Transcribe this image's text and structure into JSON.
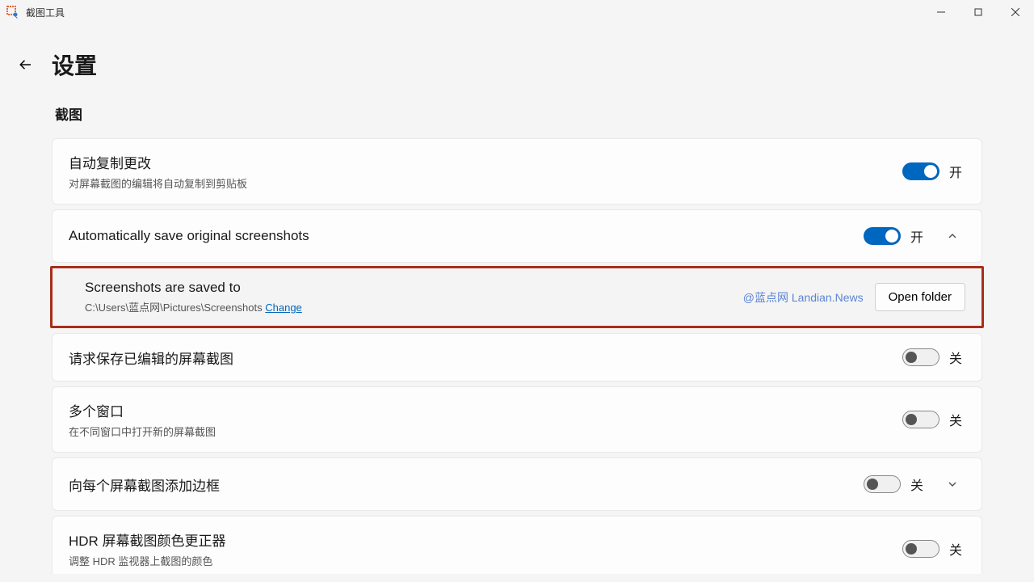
{
  "window": {
    "appTitle": "截图工具"
  },
  "header": {
    "pageTitle": "设置"
  },
  "section": {
    "label": "截图"
  },
  "toggleLabels": {
    "on": "开",
    "off": "关"
  },
  "rows": {
    "autoCopy": {
      "title": "自动复制更改",
      "subtitle": "对屏幕截图的编辑将自动复制到剪贴板"
    },
    "autoSave": {
      "title": "Automatically save original screenshots"
    },
    "screenshotsSaved": {
      "title": "Screenshots are saved to",
      "path": "C:\\Users\\蓝点网\\Pictures\\Screenshots",
      "changeLabel": "Change",
      "watermark": "@蓝点网 Landian.News",
      "openFolderLabel": "Open folder"
    },
    "askSaveEdited": {
      "title": "请求保存已编辑的屏幕截图"
    },
    "multiWindow": {
      "title": "多个窗口",
      "subtitle": "在不同窗口中打开新的屏幕截图"
    },
    "addBorder": {
      "title": "向每个屏幕截图添加边框"
    },
    "hdrCorrector": {
      "title": "HDR 屏幕截图颜色更正器",
      "subtitle": "调整 HDR 监视器上截图的颜色"
    }
  }
}
